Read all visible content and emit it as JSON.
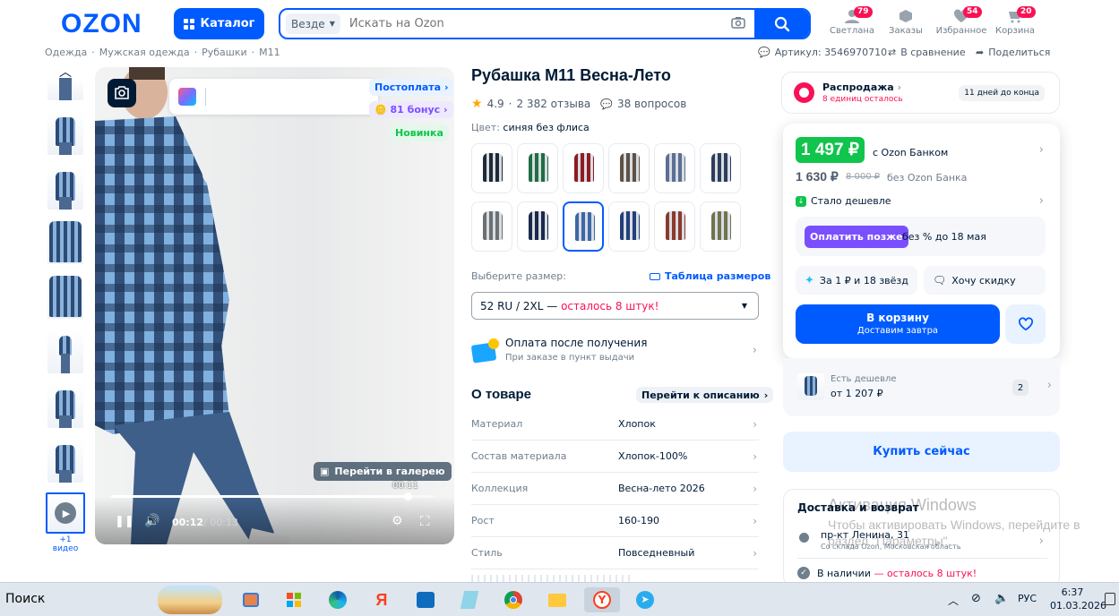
{
  "header": {
    "logo": "OZON",
    "catalog_label": "Каталог",
    "search_scope": "Везде",
    "search_placeholder": "Искать на Ozon",
    "nav": [
      {
        "label": "Светлана",
        "badge": "79",
        "icon": "user-icon"
      },
      {
        "label": "Заказы",
        "badge": "",
        "icon": "box-icon"
      },
      {
        "label": "Избранное",
        "badge": "54",
        "icon": "heart-icon"
      },
      {
        "label": "Корзина",
        "badge": "20",
        "icon": "cart-icon"
      }
    ]
  },
  "breadcrumbs": [
    "Одежда",
    "Мужская одежда",
    "Рубашки",
    "M11"
  ],
  "meta": {
    "article": "Артикул: 3546970710",
    "compare": "В сравнение",
    "share": "Поделиться"
  },
  "gallery": {
    "thumb_count": 8,
    "video_label": "+1 видео",
    "tags": {
      "postpay": "Постоплата",
      "bonus": "81 бонус",
      "new": "Новинка"
    },
    "gallery_button": "Перейти в галерею",
    "time_tooltip": "00:11",
    "time_current": "00:12",
    "time_total": "/ 00:13",
    "progress": 0.92
  },
  "product": {
    "title": "Рубашка M11 Весна-Лето",
    "rating": "4.9",
    "reviews": "2 382 отзыва",
    "questions": "38 вопросов",
    "color_label": "Цвет:",
    "color_value": "синяя без флиса",
    "swatch_colors": [
      "#1e2a38",
      "#1f6e44",
      "#8e1c22",
      "#5e5145",
      "#5c6f94",
      "#2d3e5b",
      "#6b7073",
      "#1b2a4a",
      "#3f67a8",
      "#233f7b",
      "#8b3a2c",
      "#6f7350"
    ],
    "selected_swatch": 8,
    "size_label": "Выберите размер:",
    "size_table": "Таблица размеров",
    "size_value": "52 RU / 2XL — ",
    "size_stock": "осталось 8 штук!",
    "pay_title": "Оплата после получения",
    "pay_sub": "При заказе в пункт выдачи",
    "about_title": "О товаре",
    "to_description": "Перейти к описанию",
    "specs": [
      {
        "k": "Материал",
        "v": "Хлопок"
      },
      {
        "k": "Состав материала",
        "v": "Хлопок-100%"
      },
      {
        "k": "Коллекция",
        "v": "Весна-лето 2026"
      },
      {
        "k": "Рост",
        "v": "160-190"
      },
      {
        "k": "Стиль",
        "v": "Повседневный"
      }
    ]
  },
  "buybox": {
    "sale_title": "Распродажа",
    "sale_units": "8 единиц осталось",
    "sale_timer": "11 дней до конца",
    "price_card": "1 497 ₽",
    "price_card_label": "с Ozon Банком",
    "price_regular": "1 630 ₽",
    "price_old": "8 000 ₽",
    "price_regular_label": "без Ozon Банка",
    "cheaper": "Стало дешевле",
    "pay_later_btn": "Оплатить позже",
    "pay_later_text": "без % до 18 мая",
    "stars_offer": "За 1 ₽ и 18 звёзд",
    "discount_offer": "Хочу скидку",
    "cart_btn": "В корзину",
    "cart_sub": "Доставим завтра",
    "cheaper_title": "Есть дешевле",
    "cheaper_price": "от 1 207 ₽",
    "cheaper_count": "2",
    "buy_now": "Купить сейчас",
    "delivery_title": "Доставка и возврат",
    "address": "пр-кт Ленина, 31",
    "address_sub": "Со склада Ozon, Московская область",
    "in_stock": "В наличии",
    "in_stock_rest": " — осталось 8 штук!"
  },
  "watermark": {
    "title": "Активация Windows",
    "line": "Чтобы активировать Windows, перейдите в",
    "line2": "раздел \"Параметры\"."
  },
  "taskbar": {
    "search": "Поиск",
    "lang": "РУС",
    "time": "6:37",
    "date": "01.03.2026"
  },
  "colors": {
    "brand": "#005bff",
    "accent_pink": "#f91155",
    "price_green": "#10c44c",
    "pay_later": "#7a4fff"
  }
}
